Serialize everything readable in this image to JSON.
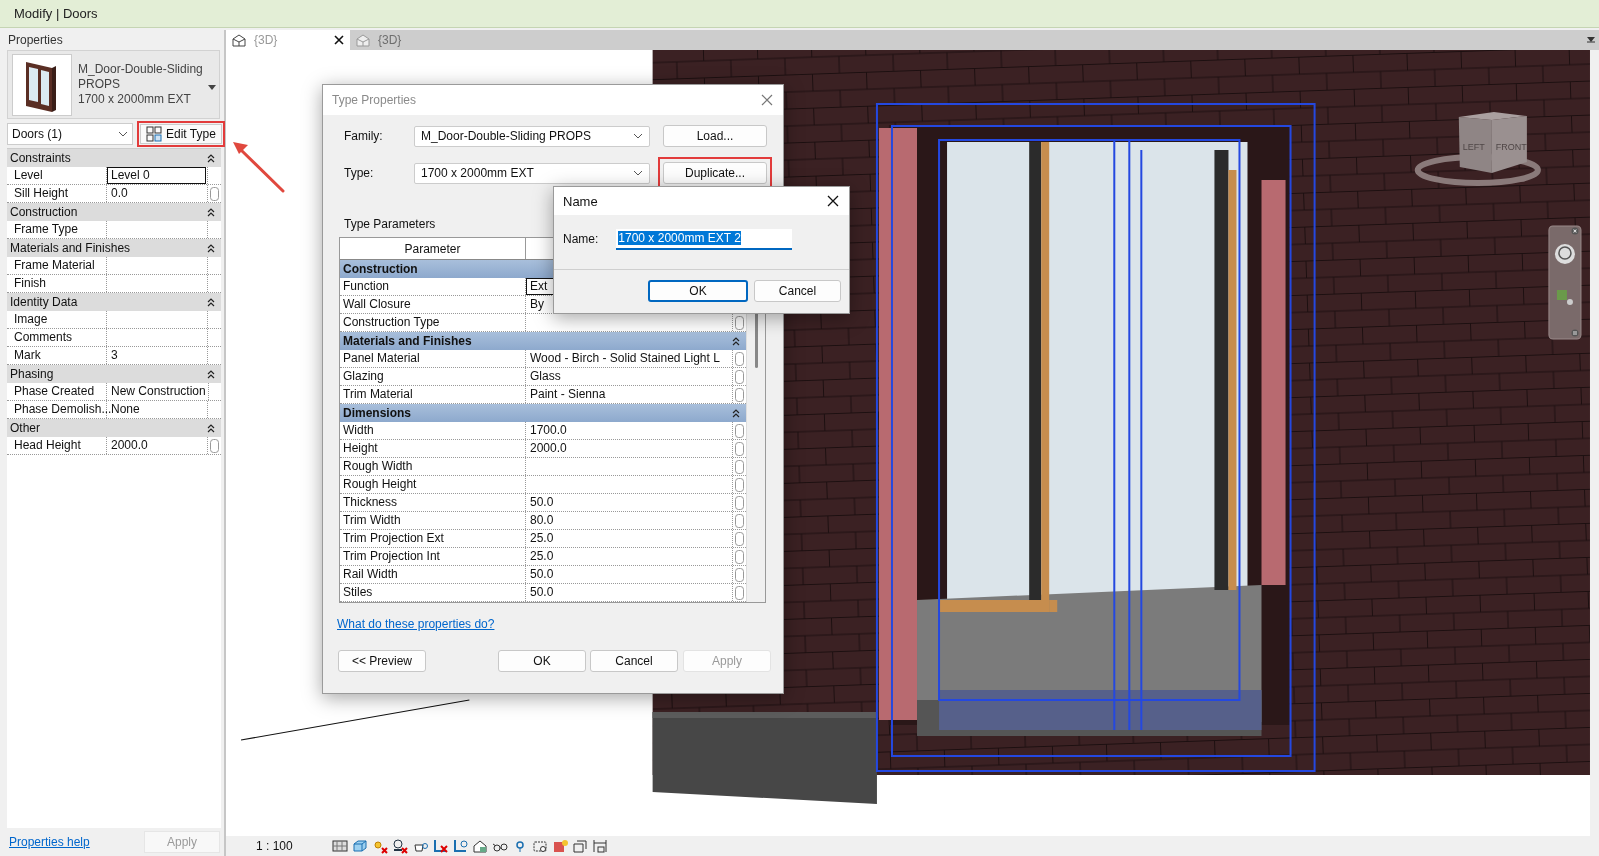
{
  "ribbon": {
    "context_title": "Modify | Doors"
  },
  "properties": {
    "title": "Properties",
    "family": "M_Door-Double-Sliding PROPS",
    "type": "1700 x 2000mm EXT",
    "filter": "Doors (1)",
    "edit_type": {
      "label": "Edit Type",
      "highlighted": true
    },
    "groups": [
      {
        "name": "Constraints",
        "expanded": true,
        "rows": [
          {
            "label": "Level",
            "value": "Level 0",
            "editing": true,
            "linkable": false
          },
          {
            "label": "Sill Height",
            "value": "0.0",
            "editing": false,
            "linkable": true
          }
        ]
      },
      {
        "name": "Construction",
        "expanded": true,
        "rows": [
          {
            "label": "Frame Type",
            "editing": false,
            "linkable": false
          }
        ]
      },
      {
        "name": "Materials and Finishes",
        "expanded": true,
        "rows": [
          {
            "label": "Frame Material",
            "editing": false,
            "linkable": false
          },
          {
            "label": "Finish",
            "editing": false,
            "linkable": false
          }
        ]
      },
      {
        "name": "Identity Data",
        "expanded": true,
        "rows": [
          {
            "label": "Image",
            "editing": false,
            "linkable": false
          },
          {
            "label": "Comments",
            "editing": false,
            "linkable": false
          },
          {
            "label": "Mark",
            "value": "3",
            "editing": false,
            "linkable": false
          }
        ]
      },
      {
        "name": "Phasing",
        "expanded": true,
        "rows": [
          {
            "label": "Phase Created",
            "value": "New Construction",
            "editing": false,
            "linkable": false
          },
          {
            "label": "Phase Demolish...",
            "value": "None",
            "editing": false,
            "linkable": false
          }
        ]
      },
      {
        "name": "Other",
        "expanded": true,
        "rows": [
          {
            "label": "Head Height",
            "value": "2000.0",
            "editing": false,
            "linkable": true
          }
        ]
      }
    ],
    "help_link": "Properties help",
    "apply": {
      "label": "Apply",
      "disabled": true
    }
  },
  "view_tabs": [
    {
      "label": "{3D}",
      "selected": true
    },
    {
      "label": "{3D}",
      "selected": false
    }
  ],
  "viewcube": {
    "faces": [
      "LEFT",
      "FRONT"
    ]
  },
  "view_status": {
    "scale": "1 : 100"
  },
  "type_properties": {
    "title": "Type Properties",
    "family_label": "Family:",
    "family": "M_Door-Double-Sliding PROPS",
    "type_label": "Type:",
    "type": "1700 x 2000mm EXT",
    "buttons": [
      {
        "label": "Load...",
        "highlighted": false
      },
      {
        "label": "Duplicate...",
        "highlighted": true
      }
    ],
    "section": "Type Parameters",
    "columns": [
      "Parameter"
    ],
    "groups": [
      {
        "name": "Construction",
        "expanded": true,
        "rows": [
          {
            "label": "Function",
            "value": "Ext",
            "editing": true
          },
          {
            "label": "Wall Closure",
            "value": "By",
            "editing": false
          },
          {
            "label": "Construction Type",
            "editing": false,
            "linkable": true
          }
        ]
      },
      {
        "name": "Materials and Finishes",
        "expanded": true,
        "rows": [
          {
            "label": "Panel Material",
            "value": "Wood - Birch - Solid Stained Light L",
            "editing": false,
            "linkable": true
          },
          {
            "label": "Glazing",
            "value": "Glass",
            "editing": false,
            "linkable": true
          },
          {
            "label": "Trim Material",
            "value": "Paint - Sienna",
            "editing": false,
            "linkable": true
          }
        ]
      },
      {
        "name": "Dimensions",
        "expanded": true,
        "rows": [
          {
            "label": "Width",
            "value": "1700.0",
            "editing": false,
            "linkable": true
          },
          {
            "label": "Height",
            "value": "2000.0",
            "editing": false,
            "linkable": true
          },
          {
            "label": "Rough Width",
            "editing": false,
            "linkable": true
          },
          {
            "label": "Rough Height",
            "editing": false,
            "linkable": true
          },
          {
            "label": "Thickness",
            "value": "50.0",
            "editing": false,
            "linkable": true
          },
          {
            "label": "Trim Width",
            "value": "80.0",
            "editing": false,
            "linkable": true
          },
          {
            "label": "Trim Projection Ext",
            "value": "25.0",
            "editing": false,
            "linkable": true
          },
          {
            "label": "Trim Projection Int",
            "value": "25.0",
            "editing": false,
            "linkable": true
          },
          {
            "label": "Rail Width",
            "value": "50.0",
            "editing": false,
            "linkable": true
          },
          {
            "label": "Stiles",
            "value": "50.0",
            "editing": false,
            "linkable": true
          }
        ]
      }
    ],
    "help_link": "What do these properties do?",
    "footer_buttons": [
      {
        "label": "<< Preview",
        "disabled": false
      },
      {
        "label": "OK",
        "disabled": false
      },
      {
        "label": "Cancel",
        "disabled": false
      },
      {
        "label": "Apply",
        "disabled": true
      }
    ]
  },
  "name_dialog": {
    "title": "Name",
    "field_label": "Name:",
    "value": "1700 x 2000mm EXT 2",
    "text_selected": true,
    "buttons": [
      {
        "label": "OK",
        "default": true
      },
      {
        "label": "Cancel",
        "default": false
      }
    ]
  }
}
